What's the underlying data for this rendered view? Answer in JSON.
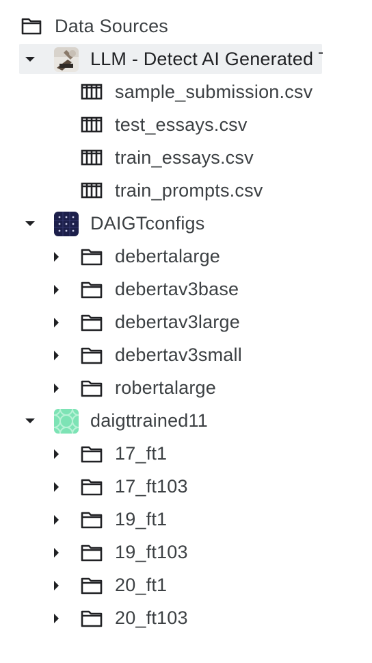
{
  "header": {
    "label": "Data Sources",
    "icon": "folder-icon"
  },
  "datasets": [
    {
      "name": "LLM - Detect AI Generated Text",
      "thumb": "llm-thumbnail",
      "expanded": true,
      "selected": true,
      "children": [
        {
          "label": "sample_submission.csv",
          "icon": "table-icon"
        },
        {
          "label": "test_essays.csv",
          "icon": "table-icon"
        },
        {
          "label": "train_essays.csv",
          "icon": "table-icon"
        },
        {
          "label": "train_prompts.csv",
          "icon": "table-icon"
        }
      ]
    },
    {
      "name": "DAIGTconfigs",
      "thumb": "daigtconfigs-thumbnail",
      "expanded": true,
      "selected": false,
      "children": [
        {
          "label": "debertalarge",
          "icon": "folder-icon"
        },
        {
          "label": "debertav3base",
          "icon": "folder-icon"
        },
        {
          "label": "debertav3large",
          "icon": "folder-icon"
        },
        {
          "label": "debertav3small",
          "icon": "folder-icon"
        },
        {
          "label": "robertalarge",
          "icon": "folder-icon"
        }
      ]
    },
    {
      "name": "daigttrained11",
      "thumb": "daigttrained11-thumbnail",
      "expanded": true,
      "selected": false,
      "children": [
        {
          "label": "17_ft1",
          "icon": "folder-icon"
        },
        {
          "label": "17_ft103",
          "icon": "folder-icon"
        },
        {
          "label": "19_ft1",
          "icon": "folder-icon"
        },
        {
          "label": "19_ft103",
          "icon": "folder-icon"
        },
        {
          "label": "20_ft1",
          "icon": "folder-icon"
        },
        {
          "label": "20_ft103",
          "icon": "folder-icon"
        }
      ]
    }
  ],
  "colors": {
    "text": "#3c4043",
    "icon": "#202124",
    "selected_bg": "#eef0f2",
    "daigtconfigs_thumb": "#1c1f4a",
    "daigttrained_thumb": "#7de3b5"
  }
}
